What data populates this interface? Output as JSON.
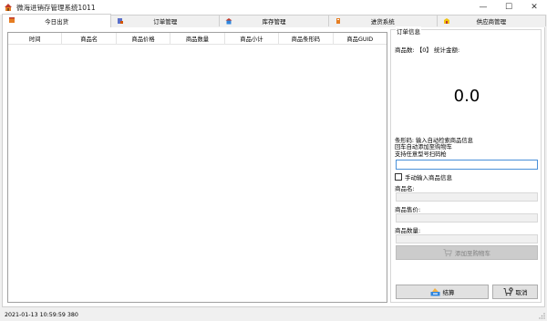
{
  "window": {
    "title": "微海进销存管理系统1011",
    "minimize_glyph": "—",
    "maximize_glyph": "☐",
    "close_glyph": "✕"
  },
  "tabs": [
    {
      "label": "今日出货",
      "active": true,
      "icon": "shipping-icon"
    },
    {
      "label": "订单管理",
      "active": false,
      "icon": "order-icon"
    },
    {
      "label": "库存管理",
      "active": false,
      "icon": "warehouse-icon"
    },
    {
      "label": "进货系统",
      "active": false,
      "icon": "purchase-icon"
    },
    {
      "label": "供应商管理",
      "active": false,
      "icon": "supplier-icon"
    }
  ],
  "grid": {
    "columns": [
      "时间",
      "商品名",
      "商品价格",
      "商品数量",
      "商品小计",
      "商品条形码",
      "商品GUID"
    ]
  },
  "order": {
    "group_title": "订单信息",
    "summary": "商品数: 【0】 统计金额:",
    "total": "0.0",
    "barcode_hint_1": "条形码: 输入自动检索商品信息",
    "barcode_hint_2": "回车自动添加至购物车",
    "barcode_hint_3": "支持任意型号扫码枪",
    "barcode_value": "",
    "manual_label": "手动输入商品信息",
    "manual_checked": false,
    "name_label": "商品名:",
    "name_value": "",
    "price_label": "商品售价:",
    "price_value": "",
    "qty_label": "商品数量:",
    "qty_value": "",
    "add_to_cart_label": "添加至购物车",
    "checkout_label": "结算",
    "cancel_label": "取消"
  },
  "status": {
    "text": "2021-01-13 10:59:59 380"
  },
  "colors": {
    "focus_border": "#4a90d9",
    "disabled_button": "#cccccc",
    "background": "#f0f0f0"
  }
}
